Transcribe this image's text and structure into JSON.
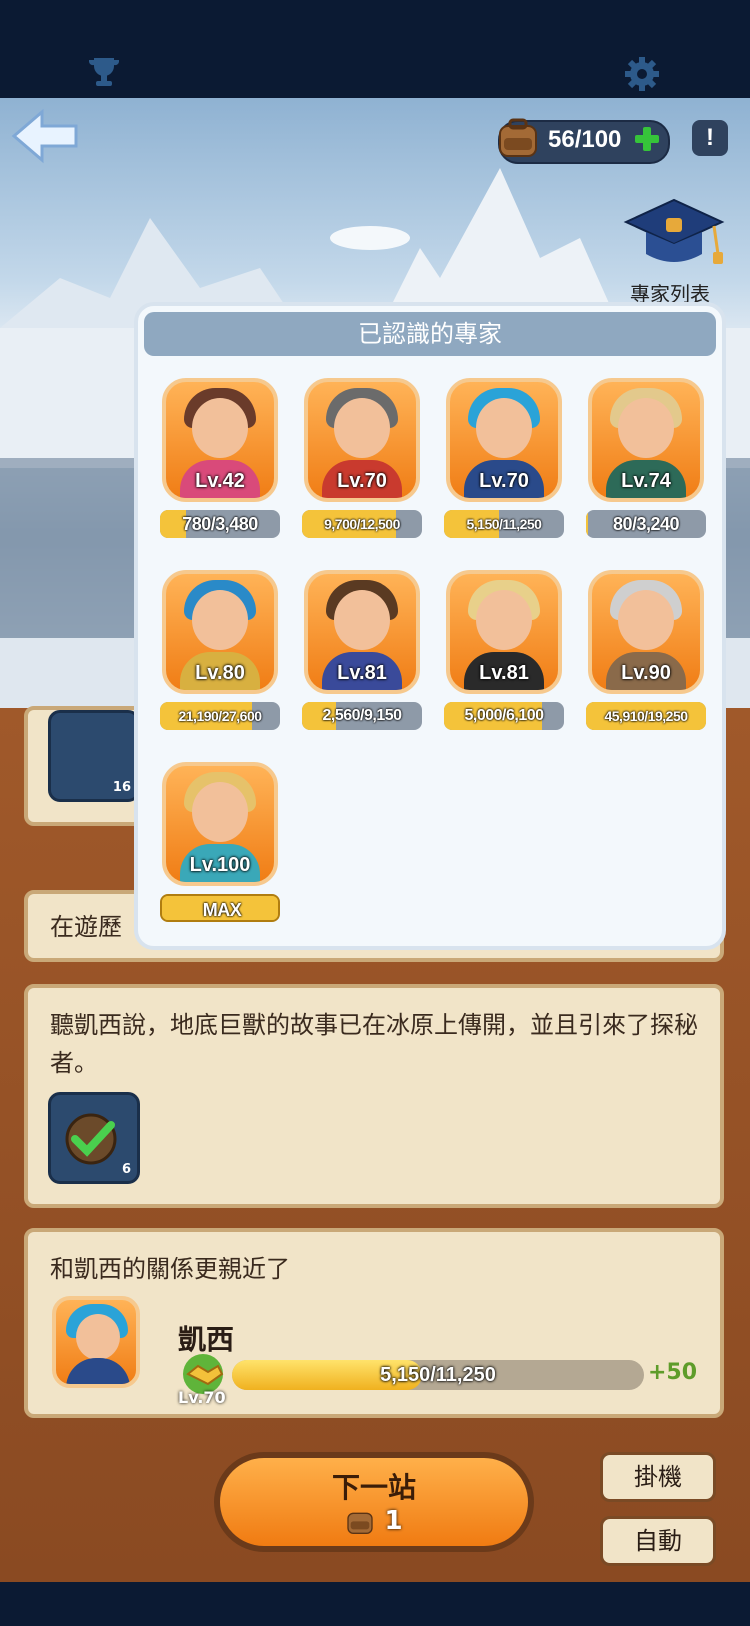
{
  "header": {
    "resource_count": "56/100",
    "help_label": "!",
    "experts_label": "專家列表",
    "icons": [
      "trophy-icon",
      "gear-icon",
      "back-arrow-icon",
      "backpack-icon",
      "plus-icon",
      "help-icon",
      "graduation-cap-icon"
    ]
  },
  "overlay": {
    "title": "已認識的專家",
    "experts": [
      {
        "level": "Lv.42",
        "progress": "780/3,480",
        "fill": 0.22,
        "hair": "#6a3b2a",
        "body": "#d94a7a"
      },
      {
        "level": "Lv.70",
        "progress": "9,700/12,500",
        "fill": 0.78,
        "hair": "#6b6b6b",
        "body": "#c93a2e"
      },
      {
        "level": "Lv.70",
        "progress": "5,150/11,250",
        "fill": 0.46,
        "hair": "#2aa3d8",
        "body": "#2a4a8a"
      },
      {
        "level": "Lv.74",
        "progress": "80/3,240",
        "fill": 0.02,
        "hair": "#e3c98c",
        "body": "#2d6a58"
      },
      {
        "level": "Lv.80",
        "progress": "21,190/27,600",
        "fill": 0.77,
        "hair": "#2a8ac8",
        "body": "#d8b040"
      },
      {
        "level": "Lv.81",
        "progress": "2,560/9,150",
        "fill": 0.28,
        "hair": "#5a3a22",
        "body": "#3a4a9a"
      },
      {
        "level": "Lv.81",
        "progress": "5,000/6,100",
        "fill": 0.82,
        "hair": "#e8d08a",
        "body": "#2a2a2a"
      },
      {
        "level": "Lv.90",
        "progress": "45,910/19,250",
        "fill": 1.0,
        "hair": "#cfcfcf",
        "body": "#8a6a4a"
      },
      {
        "level": "Lv.100",
        "progress": "MAX",
        "fill": 1.0,
        "hair": "#e6c26a",
        "body": "#3aa8b8"
      }
    ]
  },
  "cards": {
    "card1_text": "在遊歷",
    "card1_badge_count": "16",
    "card2_text": "聽凱西說，地底巨獸的故事已在冰原上傳開，並且引來了探秘者。",
    "card2_badge_count": "6",
    "card3_title": "和凱西的關係更親近了",
    "character_name": "凱西",
    "character_level": "Lv.70",
    "relationship_progress": "5,150/11,250",
    "relationship_fill": 0.46,
    "relationship_bonus": "+50"
  },
  "footer": {
    "next_label": "下一站",
    "next_cost": "1",
    "idle_label": "掛機",
    "auto_label": "自動"
  }
}
